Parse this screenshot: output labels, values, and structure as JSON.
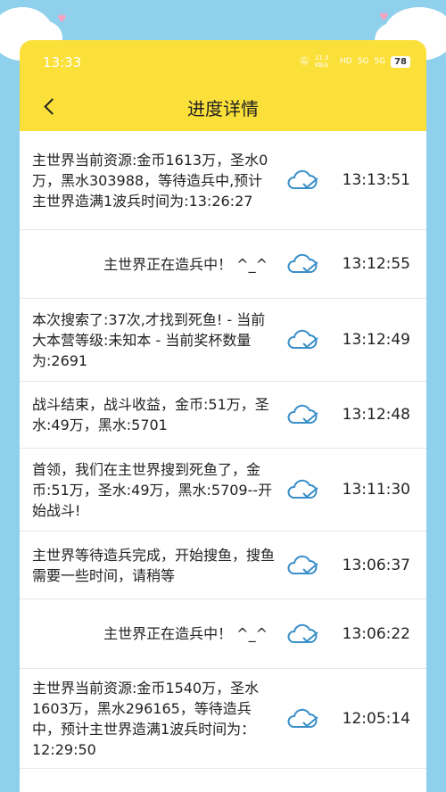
{
  "status_bar": {
    "time": "13:33",
    "net_speed": "11.5 KB/s",
    "hd_label": "HD",
    "signal1": "5G",
    "signal2": "5G",
    "battery": "78"
  },
  "header": {
    "back_icon": "chevron-left-icon",
    "title": "进度详情"
  },
  "rows": [
    {
      "text": "主世界当前资源:金币1613万，圣水0万，黑水303988，等待造兵中,预计主世界造满1波兵时间为:13:26:27",
      "time": "13:13:51"
    },
    {
      "text": "主世界正在造兵中！ ^_^",
      "time": "13:12:55"
    },
    {
      "text": "本次搜索了:37次,才找到死鱼! - 当前大本营等级:未知本 - 当前奖杯数量为:2691",
      "time": "13:12:49"
    },
    {
      "text": "战斗结束，战斗收益，金币:51万，圣水:49万，黑水:5701",
      "time": "13:12:48"
    },
    {
      "text": "首领，我们在主世界搜到死鱼了，金币:51万，圣水:49万，黑水:5709--开始战斗!",
      "time": "13:11:30"
    },
    {
      "text": "主世界等待造兵完成，开始搜鱼，搜鱼需要一些时间，请稍等",
      "time": "13:06:37"
    },
    {
      "text": "主世界正在造兵中！ ^_^",
      "time": "13:06:22"
    },
    {
      "text": "主世界当前资源:金币1540万，圣水1603万，黑水296165，等待造兵中，预计主世界造满1波兵时间为：12:29:50",
      "time": "12:05:14"
    }
  ],
  "colors": {
    "header_bg": "#fbe03a",
    "page_bg": "#8fd0ec",
    "cloud_icon": "#3a8fc9"
  }
}
